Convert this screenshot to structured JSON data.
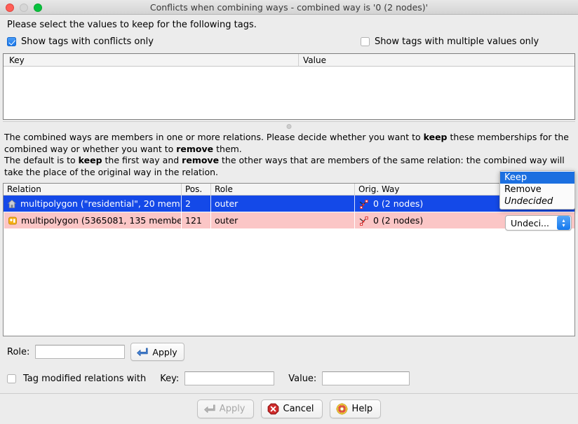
{
  "window": {
    "title": "Conflicts when combining ways - combined way is '0 (2 nodes)'",
    "controls": {
      "close": "close-button",
      "minimize": "minimize-button",
      "maximize": "maximize-button"
    }
  },
  "top": {
    "instruction": "Please select the values to keep for the following tags.",
    "checkbox_conflicts_label": "Show tags with conflicts only",
    "checkbox_conflicts_checked": true,
    "checkbox_multiple_label": "Show tags with multiple values only",
    "checkbox_multiple_checked": false
  },
  "tag_table": {
    "columns": [
      "Key",
      "Value"
    ],
    "rows": []
  },
  "explain": {
    "line1_a": "The combined ways are members in one or more relations. Please decide whether you want to ",
    "line1_b": "keep",
    "line1_c": " these memberships for the combined way or whether you want to ",
    "line1_d": "remove",
    "line1_e": " them.",
    "line2_a": "The default is to ",
    "line2_b": "keep",
    "line2_c": " the first way and ",
    "line2_d": "remove",
    "line2_e": " the other ways that are members of the same relation: the combined way will take the place of the original way in the relation."
  },
  "relation_table": {
    "columns": [
      "Relation",
      "Pos.",
      "Role",
      "Orig. Way"
    ],
    "rows": [
      {
        "icon": "relation-house-icon",
        "relation": "multipolygon (\"residential\", 20 memb...",
        "pos": "2",
        "role": "outer",
        "way_icon": "way-icon",
        "orig_way": "0 (2 nodes)",
        "selected": true
      },
      {
        "icon": "relation-generic-icon",
        "relation": "multipolygon (5365081, 135 membe...",
        "pos": "121",
        "role": "outer",
        "way_icon": "way-icon",
        "orig_way": "0 (2 nodes)",
        "selected": false
      }
    ]
  },
  "decision_combo": {
    "value": "Undeci...",
    "arrow_up": "▴",
    "arrow_down": "▾"
  },
  "dropdown": {
    "items": [
      {
        "label": "Keep",
        "highlighted": true,
        "italic": false
      },
      {
        "label": "Remove",
        "highlighted": false,
        "italic": false
      },
      {
        "label": "Undecided",
        "highlighted": false,
        "italic": true
      }
    ]
  },
  "form": {
    "role_label": "Role:",
    "role_value": "",
    "role_apply_label": "Apply",
    "tag_checkbox_label": "Tag modified relations with",
    "tag_checkbox_checked": false,
    "key_label": "Key:",
    "key_value": "",
    "value_label": "Value:",
    "value_value": ""
  },
  "footer": {
    "apply_label": "Apply",
    "apply_enabled": false,
    "cancel_label": "Cancel",
    "help_label": "Help"
  },
  "colors": {
    "selection_blue": "#1449e8",
    "conflict_pink": "#fbc6c6",
    "accent_blue": "#1b6fe0",
    "window_bg": "#ececec"
  }
}
